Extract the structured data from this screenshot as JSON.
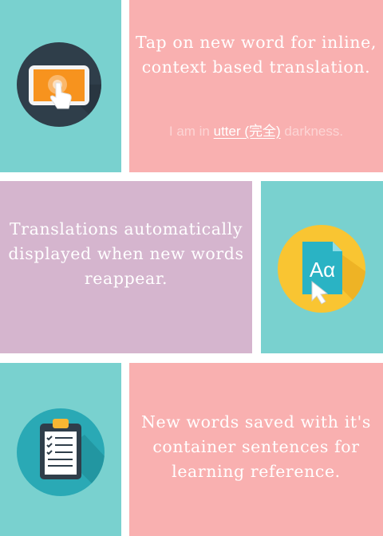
{
  "cards": [
    {
      "icon": "tablet-tap-icon",
      "text": "Tap on new word for inline, context based translation.",
      "example": {
        "before": "I am in ",
        "highlight": "utter (完全)",
        "after": " darkness."
      }
    },
    {
      "icon": "translate-document-icon",
      "text": "Translations automatically displayed when new words reappear.",
      "icon_label": "Aα"
    },
    {
      "icon": "clipboard-checklist-icon",
      "text": "New words saved with it's container sentences for learning reference."
    }
  ],
  "colors": {
    "teal": "#79d1cf",
    "pink": "#f9b0b0",
    "purple": "#d5b5ce",
    "dark_circle": "#2f3e4a",
    "yellow_circle": "#f9c532"
  }
}
